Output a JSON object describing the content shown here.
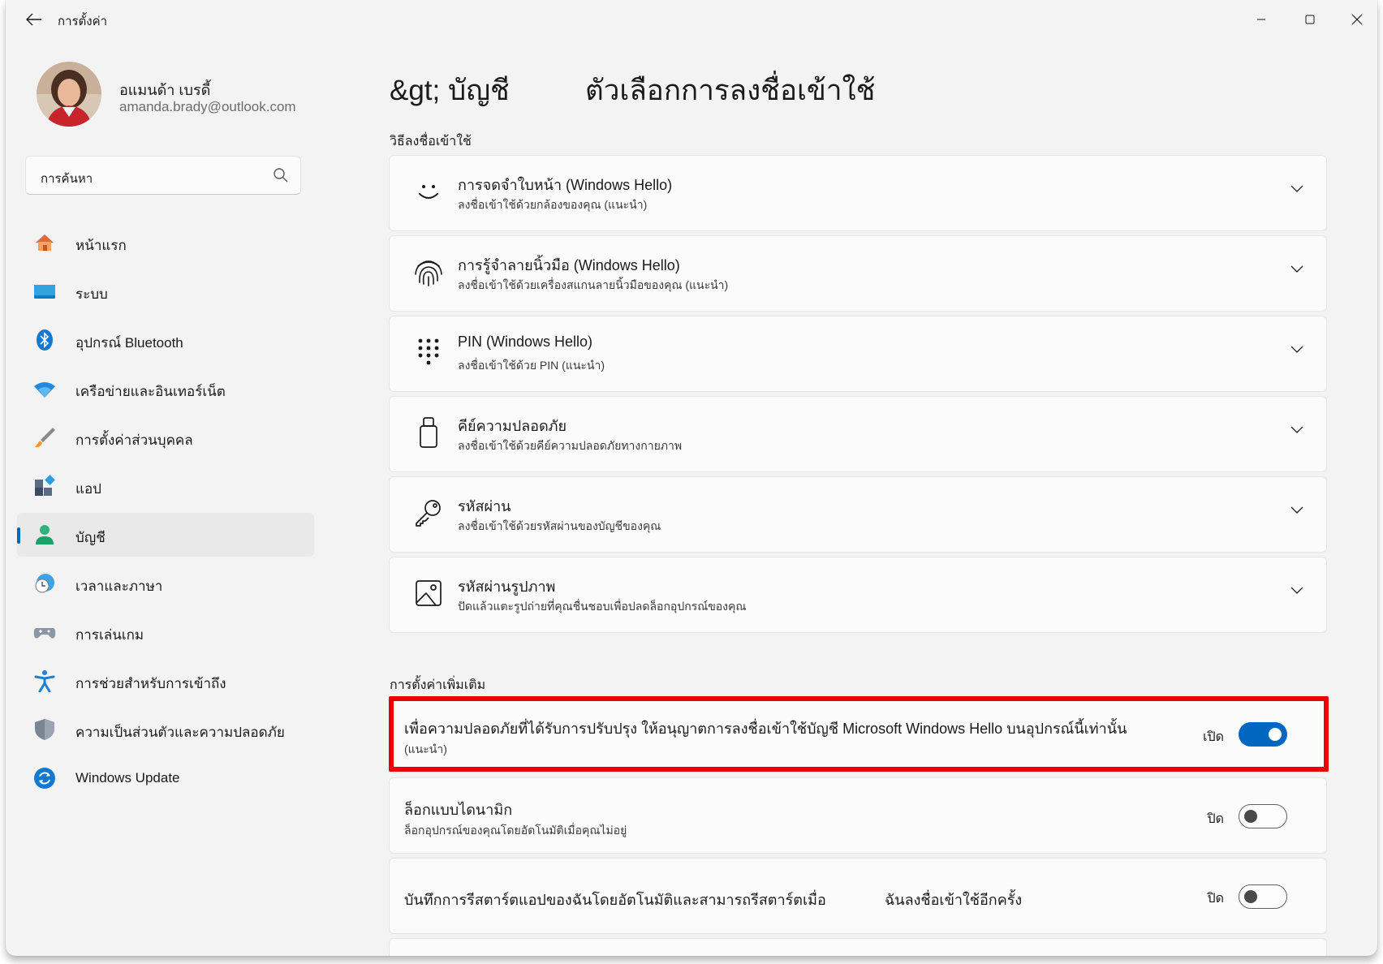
{
  "window": {
    "title": "การตั้งค่า"
  },
  "user": {
    "name": "อแมนด้า เบรดี้",
    "email": "amanda.brady@outlook.com"
  },
  "search": {
    "placeholder": "การค้นหา"
  },
  "nav": {
    "items": [
      {
        "label": "หน้าแรก",
        "icon": "home-icon"
      },
      {
        "label": "ระบบ",
        "icon": "system-icon"
      },
      {
        "label": "อุปกรณ์ Bluetooth",
        "icon": "bluetooth-icon"
      },
      {
        "label": "เครือข่ายและอินเทอร์เน็ต",
        "icon": "wifi-icon"
      },
      {
        "label": "การตั้งค่าส่วนบุคคล",
        "icon": "brush-icon"
      },
      {
        "label": "แอป",
        "icon": "apps-icon"
      },
      {
        "label": "บัญชี",
        "icon": "account-icon",
        "active": true
      },
      {
        "label": "เวลาและภาษา",
        "icon": "time-language-icon"
      },
      {
        "label": "การเล่นเกม",
        "icon": "gaming-icon"
      },
      {
        "label": "การช่วยสำหรับการเข้าถึง",
        "icon": "accessibility-icon"
      },
      {
        "label": "ความเป็นส่วนตัวและความปลอดภัย",
        "icon": "shield-icon"
      },
      {
        "label": "Windows Update",
        "icon": "windows-update-icon"
      }
    ]
  },
  "header": {
    "breadcrumb": "&gt; บัญชี",
    "title": "ตัวเลือกการลงชื่อเข้าใช้"
  },
  "signin": {
    "section_label": "วิธีลงชื่อเข้าใช้",
    "options": [
      {
        "title": "การจดจำใบหน้า (Windows Hello)",
        "subtitle": "ลงชื่อเข้าใช้ด้วยกล้องของคุณ (แนะนำ)",
        "icon": "face-icon"
      },
      {
        "title": "การรู้จำลายนิ้วมือ (Windows Hello)",
        "subtitle": "ลงชื่อเข้าใช้ด้วยเครื่องสแกนลายนิ้วมือของคุณ (แนะนำ)",
        "icon": "fingerprint-icon"
      },
      {
        "title": "PIN (Windows Hello)",
        "subtitle": "ลงชื่อเข้าใช้ด้วย    PIN (แนะนำ)",
        "icon": "pin-keypad-icon"
      },
      {
        "title": "คีย์ความปลอดภัย",
        "subtitle": "ลงชื่อเข้าใช้ด้วยคีย์ความปลอดภัยทางกายภาพ",
        "icon": "security-key-icon"
      },
      {
        "title": "รหัสผ่าน",
        "subtitle": "ลงชื่อเข้าใช้ด้วยรหัสผ่านของบัญชีของคุณ",
        "icon": "password-key-icon"
      },
      {
        "title": "รหัสผ่านรูปภาพ",
        "subtitle": "ปัดแล้วแตะรูปถ่ายที่คุณชื่นชอบเพื่อปลดล็อกอุปกรณ์ของคุณ",
        "icon": "picture-password-icon"
      }
    ]
  },
  "additional": {
    "section_label": "การตั้งค่าเพิ่มเติม",
    "settings": [
      {
        "text": "เพื่อความปลอดภัยที่ได้รับการปรับปรุง ให้อนุญาตการลงชื่อเข้าใช้บัญชี Microsoft Windows Hello บนอุปกรณ์นี้เท่านั้น",
        "subtext": "(แนะนำ)",
        "state_label": "เปิด",
        "on": true
      },
      {
        "text": "ล็อกแบบไดนามิก",
        "subtext": "ล็อกอุปกรณ์ของคุณโดยอัตโนมัติเมื่อคุณไม่อยู่",
        "state_label": "ปิด",
        "on": false
      },
      {
        "text": "บันทึกการรีสตาร์ตแอปของฉันโดยอัตโนมัติและสามารถรีสตาร์ตเมื่อ",
        "text2": "ฉันลงชื่อเข้าใช้อีกครั้ง",
        "state_label": "ปิด",
        "on": false
      }
    ]
  },
  "colors": {
    "accent": "#0067c0",
    "highlight": "#e8000b",
    "background": "#f3f3f3"
  }
}
